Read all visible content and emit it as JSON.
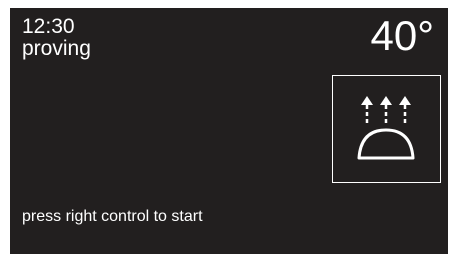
{
  "status": {
    "time": "12:30",
    "mode": "proving",
    "temperature": "40°"
  },
  "program_icon": {
    "icon": "proving-icon",
    "stroke_color": "#ffffff"
  },
  "hint": {
    "text": "press right control to start"
  },
  "colors": {
    "screen_background": "#221f1f",
    "text": "#ffffff",
    "bezel": "#ffffff"
  }
}
